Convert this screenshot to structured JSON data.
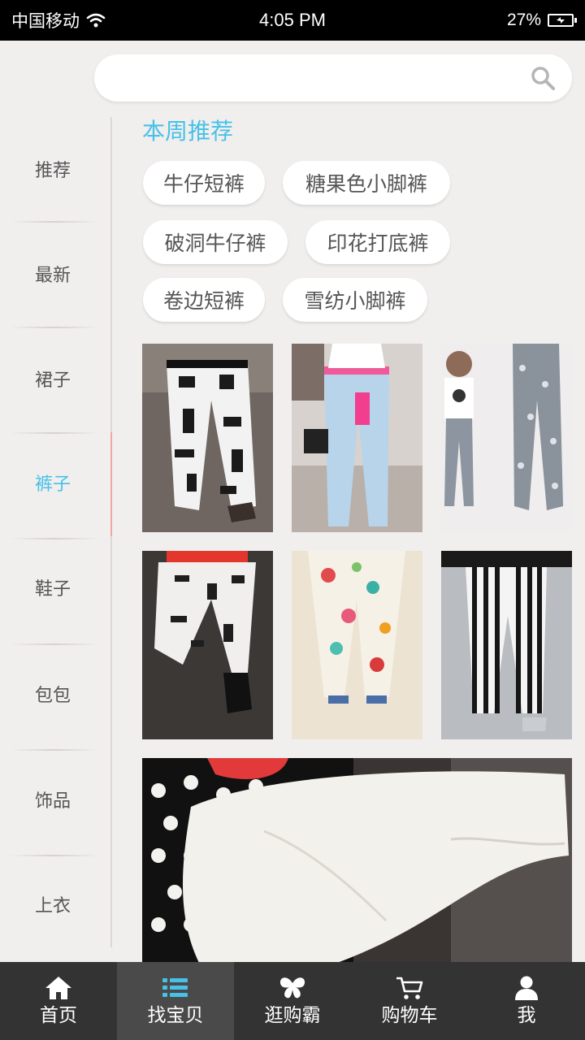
{
  "status": {
    "carrier": "中国移动",
    "time": "4:05 PM",
    "battery": "27%"
  },
  "search": {
    "value": "",
    "placeholder": ""
  },
  "sidebar": {
    "items": [
      {
        "label": "推荐"
      },
      {
        "label": "最新"
      },
      {
        "label": "裙子"
      },
      {
        "label": "裤子"
      },
      {
        "label": "鞋子"
      },
      {
        "label": "包包"
      },
      {
        "label": "饰品"
      },
      {
        "label": "上衣"
      }
    ],
    "active_index": 3
  },
  "section": {
    "title": "本周推荐"
  },
  "tags": [
    {
      "label": "牛仔短裤"
    },
    {
      "label": "糖果色小脚裤"
    },
    {
      "label": "破洞牛仔裤"
    },
    {
      "label": "印花打底裤"
    },
    {
      "label": "卷边短裤"
    },
    {
      "label": "雪纺小脚裤"
    }
  ],
  "products": [
    {
      "icon": "product-photo"
    },
    {
      "icon": "product-photo"
    },
    {
      "icon": "product-photo"
    },
    {
      "icon": "product-photo"
    },
    {
      "icon": "product-photo"
    },
    {
      "icon": "product-photo"
    }
  ],
  "nav": {
    "items": [
      {
        "label": "首页",
        "icon": "home-icon"
      },
      {
        "label": "找宝贝",
        "icon": "list-icon"
      },
      {
        "label": "逛购霸",
        "icon": "butterfly-icon"
      },
      {
        "label": "购物车",
        "icon": "cart-icon"
      },
      {
        "label": "我",
        "icon": "user-icon"
      }
    ],
    "active_index": 1
  },
  "colors": {
    "accent": "#47c1e8",
    "nav_bg": "#333333",
    "page_bg": "#f1eeee"
  }
}
